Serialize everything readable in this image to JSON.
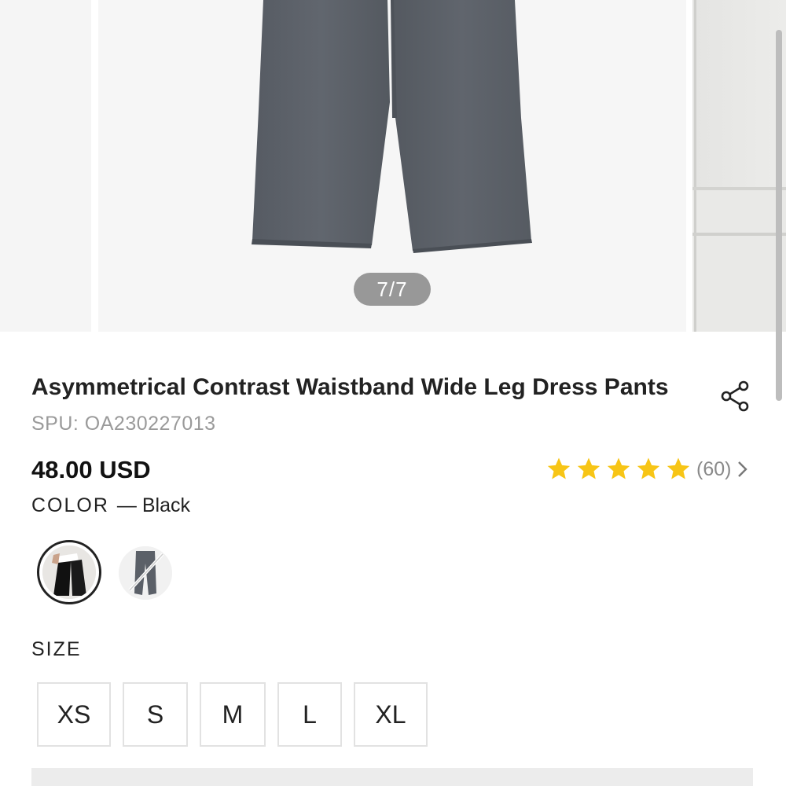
{
  "gallery": {
    "counter": "7/7"
  },
  "product": {
    "title": "Asymmetrical Contrast Waistband Wide Leg Dress Pants",
    "spu": "SPU: OA230227013",
    "price": "48.00 USD",
    "rating": {
      "stars": 5,
      "review_count": "(60)"
    }
  },
  "color": {
    "label": "COLOR",
    "selected": "Black",
    "options": [
      {
        "name": "Black",
        "selected": true
      },
      {
        "name": "Grey",
        "selected": false
      }
    ]
  },
  "size": {
    "label": "SIZE",
    "options": [
      "XS",
      "S",
      "M",
      "L",
      "XL"
    ]
  },
  "colors": {
    "star": "#f7c516",
    "pants_grey": "#5b6068"
  }
}
